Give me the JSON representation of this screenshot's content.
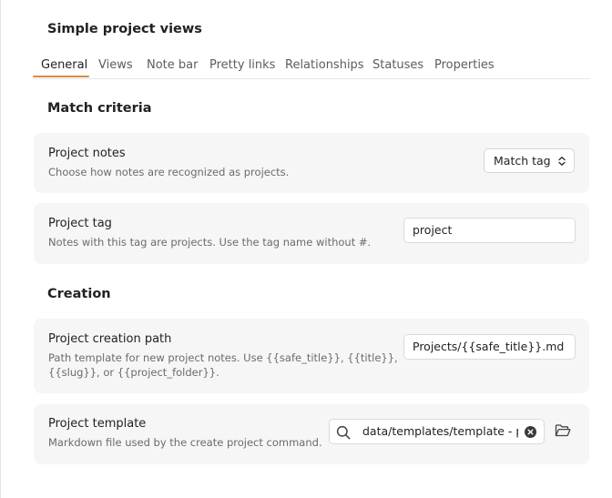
{
  "page": {
    "title": "Simple project views"
  },
  "tabs": [
    {
      "label": "General",
      "active": true
    },
    {
      "label": "Views",
      "active": false
    },
    {
      "label": "Note bar",
      "active": false
    },
    {
      "label": "Pretty links",
      "active": false
    },
    {
      "label": "Relationships",
      "active": false
    },
    {
      "label": "Statuses",
      "active": false
    },
    {
      "label": "Properties",
      "active": false
    }
  ],
  "sections": {
    "match_criteria": {
      "heading": "Match criteria",
      "project_notes": {
        "name": "Project notes",
        "description": "Choose how notes are recognized as projects.",
        "selected": "Match tag"
      },
      "project_tag": {
        "name": "Project tag",
        "description": "Notes with this tag are projects. Use the tag name without #.",
        "value": "project"
      }
    },
    "creation": {
      "heading": "Creation",
      "creation_path": {
        "name": "Project creation path",
        "description_line1": "Path template for new project notes. Use {{safe_title}}, {{title}},",
        "description_line2": "{{slug}}, or {{project_folder}}.",
        "value": "Projects/{{safe_title}}.md"
      },
      "project_template": {
        "name": "Project template",
        "description": "Markdown file used by the create project command.",
        "value": "data/templates/template - pr"
      }
    }
  },
  "icons": {
    "select_arrow": "chevron-up-down-icon",
    "search": "search-icon",
    "clear": "clear-circle-icon",
    "folder": "folder-open-icon"
  },
  "colors": {
    "accent": "#d98a43",
    "card_background": "#f6f6f6",
    "muted_text": "#6b6b6b"
  }
}
